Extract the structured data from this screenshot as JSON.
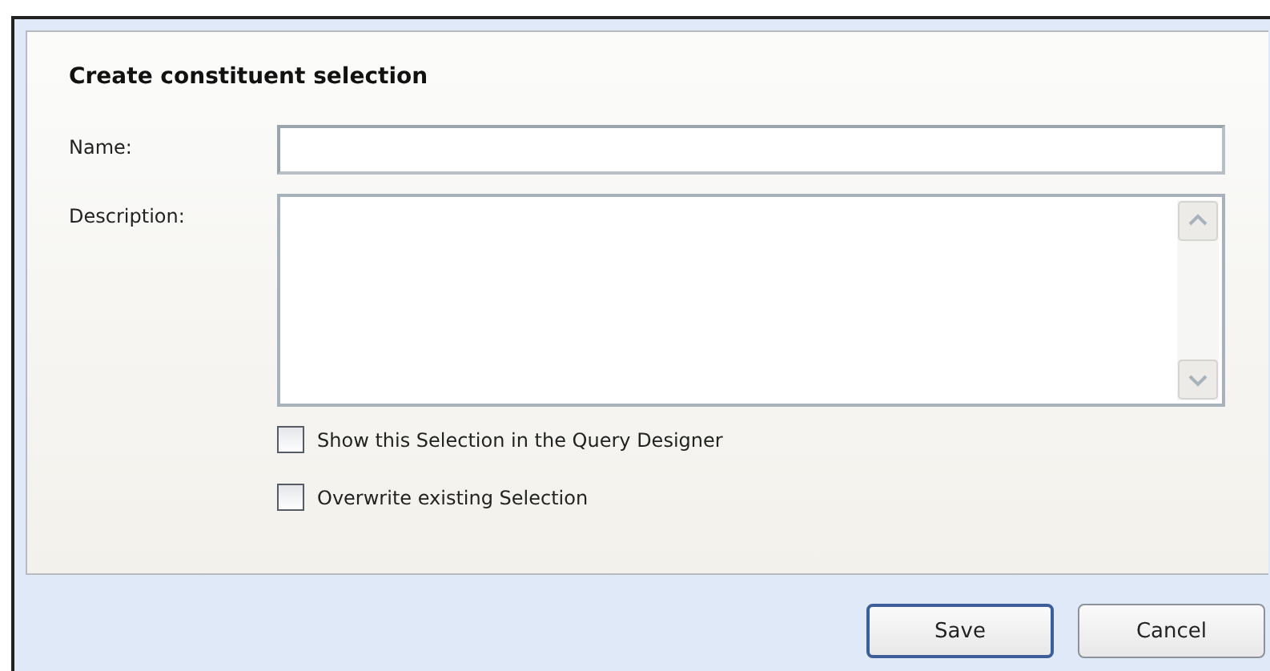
{
  "dialog": {
    "title": "Create constituent selection"
  },
  "fields": [
    {
      "kind": "text",
      "label": "Name:"
    },
    {
      "kind": "textarea",
      "label": "Description:"
    }
  ],
  "options": [
    {
      "label": "Show this Selection in the Query Designer",
      "checked": false
    },
    {
      "label": "Overwrite existing Selection",
      "checked": false
    }
  ],
  "buttons": [
    {
      "label": "Save",
      "selected": true
    },
    {
      "label": "Cancel",
      "selected": false
    }
  ]
}
